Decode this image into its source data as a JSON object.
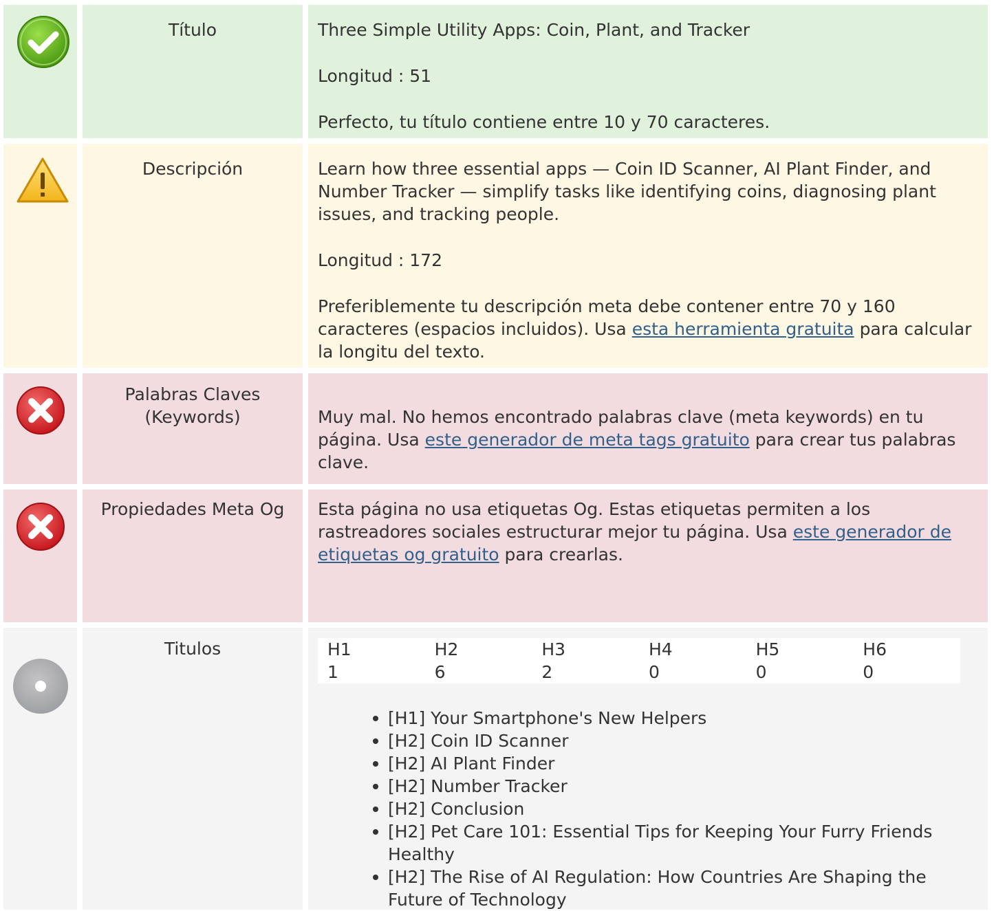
{
  "colors": {
    "success_bg": "#e0f1dc",
    "warning_bg": "#fdf7e3",
    "error_bg": "#f2dcdf",
    "info_bg": "#f4f4f4",
    "link": "#31608d"
  },
  "title_row": {
    "icon": "check-icon",
    "label": "Título",
    "value": "Three Simple Utility Apps: Coin, Plant, and Tracker",
    "length": "Longitud : 51",
    "note": "Perfecto, tu título contiene entre 10 y 70 caracteres."
  },
  "description_row": {
    "icon": "warning-icon",
    "label": "Descripción",
    "value": "Learn how three essential apps — Coin ID Scanner, AI Plant Finder, and Number Tracker — simplify tasks like identifying coins, diagnosing plant issues, and tracking people.",
    "length": "Longitud : 172",
    "note_before": "Preferiblemente tu descripción meta debe contener entre 70 y 160 caracteres (espacios incluidos). Usa",
    "note_link": "esta herramienta gratuita",
    "note_after": "para calcular la longitu del texto."
  },
  "keywords_row": {
    "icon": "error-icon",
    "label": "Palabras Claves (Keywords)",
    "note_before": "Muy mal. No hemos encontrado palabras clave (meta keywords) en tu página. Usa",
    "note_link": "este generador de meta tags gratuito",
    "note_after": "para crear tus palabras clave."
  },
  "og_row": {
    "icon": "error-icon",
    "label": "Propiedades Meta Og",
    "note_before": "Esta página no usa etiquetas Og. Estas etiquetas permiten a los rastreadores sociales estructurar mejor tu página. Usa",
    "note_link": "este generador de etiquetas og gratuito",
    "note_after": "para crearlas."
  },
  "headings_row": {
    "icon": "info-icon",
    "label": "Titulos",
    "levels": [
      "H1",
      "H2",
      "H3",
      "H4",
      "H5",
      "H6"
    ],
    "counts": [
      "1",
      "6",
      "2",
      "0",
      "0",
      "0"
    ],
    "list": [
      "[H1] Your Smartphone's New Helpers",
      "[H2] Coin ID Scanner",
      "[H2] AI Plant Finder",
      "[H2] Number Tracker",
      "[H2] Conclusion",
      "[H2] Pet Care 101: Essential Tips for Keeping Your Furry Friends Healthy",
      "[H2] The Rise of AI Regulation: How Countries Are Shaping the Future of Technology"
    ]
  }
}
